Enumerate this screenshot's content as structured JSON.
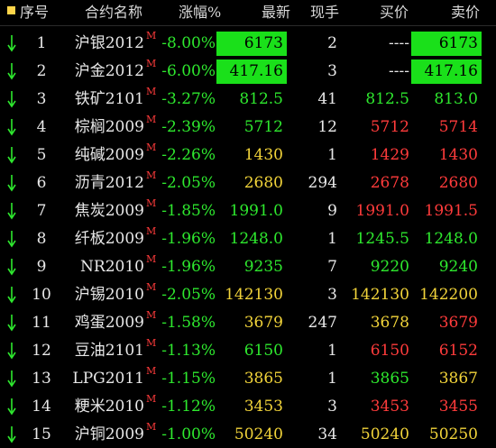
{
  "header": {
    "seq": "序号",
    "name": "合约名称",
    "change": "涨幅%",
    "last": "最新",
    "volume": "现手",
    "bid": "买价",
    "ask": "卖价"
  },
  "colors": {
    "background": "#000000",
    "up_green": "#2ee82e",
    "down_red": "#ff3b3b",
    "neutral_yellow": "#f2d43a",
    "highlight_green": "#1ae01a",
    "sort_marker": "#ffd54a"
  },
  "rows": [
    {
      "seq": "1",
      "name": "沪银2012",
      "mark": "M",
      "change": "-8.00%",
      "last": "6173",
      "last_style": "hl",
      "volume": "2",
      "bid": "----",
      "bid_style": "white",
      "ask": "6173",
      "ask_style": "hl"
    },
    {
      "seq": "2",
      "name": "沪金2012",
      "mark": "M",
      "change": "-6.00%",
      "last": "417.16",
      "last_style": "hl",
      "volume": "3",
      "bid": "----",
      "bid_style": "white",
      "ask": "417.16",
      "ask_style": "hl"
    },
    {
      "seq": "3",
      "name": "铁矿2101",
      "mark": "M",
      "change": "-3.27%",
      "last": "812.5",
      "last_style": "green",
      "volume": "41",
      "bid": "812.5",
      "bid_style": "green",
      "ask": "813.0",
      "ask_style": "green"
    },
    {
      "seq": "4",
      "name": "棕榈2009",
      "mark": "M",
      "change": "-2.39%",
      "last": "5712",
      "last_style": "green",
      "volume": "12",
      "bid": "5712",
      "bid_style": "red",
      "ask": "5714",
      "ask_style": "red"
    },
    {
      "seq": "5",
      "name": "纯碱2009",
      "mark": "M",
      "change": "-2.26%",
      "last": "1430",
      "last_style": "yellow",
      "volume": "1",
      "bid": "1429",
      "bid_style": "red",
      "ask": "1430",
      "ask_style": "red"
    },
    {
      "seq": "6",
      "name": "沥青2012",
      "mark": "M",
      "change": "-2.05%",
      "last": "2680",
      "last_style": "yellow",
      "volume": "294",
      "bid": "2678",
      "bid_style": "red",
      "ask": "2680",
      "ask_style": "red"
    },
    {
      "seq": "7",
      "name": "焦炭2009",
      "mark": "M",
      "change": "-1.85%",
      "last": "1991.0",
      "last_style": "green",
      "volume": "9",
      "bid": "1991.0",
      "bid_style": "red",
      "ask": "1991.5",
      "ask_style": "red"
    },
    {
      "seq": "8",
      "name": "纤板2009",
      "mark": "M",
      "change": "-1.96%",
      "last": "1248.0",
      "last_style": "green",
      "volume": "1",
      "bid": "1245.5",
      "bid_style": "green",
      "ask": "1248.0",
      "ask_style": "green"
    },
    {
      "seq": "9",
      "name": "NR2010",
      "mark": "M",
      "change": "-1.96%",
      "last": "9235",
      "last_style": "green",
      "volume": "7",
      "bid": "9220",
      "bid_style": "green",
      "ask": "9240",
      "ask_style": "green"
    },
    {
      "seq": "10",
      "name": "沪锡2010",
      "mark": "M",
      "change": "-2.05%",
      "last": "142130",
      "last_style": "yellow",
      "volume": "3",
      "bid": "142130",
      "bid_style": "yellow",
      "ask": "142200",
      "ask_style": "yellow"
    },
    {
      "seq": "11",
      "name": "鸡蛋2009",
      "mark": "M",
      "change": "-1.58%",
      "last": "3679",
      "last_style": "yellow",
      "volume": "247",
      "bid": "3678",
      "bid_style": "yellow",
      "ask": "3679",
      "ask_style": "red"
    },
    {
      "seq": "12",
      "name": "豆油2101",
      "mark": "M",
      "change": "-1.13%",
      "last": "6150",
      "last_style": "green",
      "volume": "1",
      "bid": "6150",
      "bid_style": "red",
      "ask": "6152",
      "ask_style": "red"
    },
    {
      "seq": "13",
      "name": "LPG2011",
      "mark": "M",
      "change": "-1.15%",
      "last": "3865",
      "last_style": "yellow",
      "volume": "1",
      "bid": "3865",
      "bid_style": "green",
      "ask": "3867",
      "ask_style": "yellow"
    },
    {
      "seq": "14",
      "name": "粳米2010",
      "mark": "M",
      "change": "-1.12%",
      "last": "3453",
      "last_style": "yellow",
      "volume": "3",
      "bid": "3453",
      "bid_style": "red",
      "ask": "3455",
      "ask_style": "red"
    },
    {
      "seq": "15",
      "name": "沪铜2009",
      "mark": "M",
      "change": "-1.00%",
      "last": "50240",
      "last_style": "yellow",
      "volume": "34",
      "bid": "50240",
      "bid_style": "yellow",
      "ask": "50250",
      "ask_style": "yellow"
    }
  ]
}
